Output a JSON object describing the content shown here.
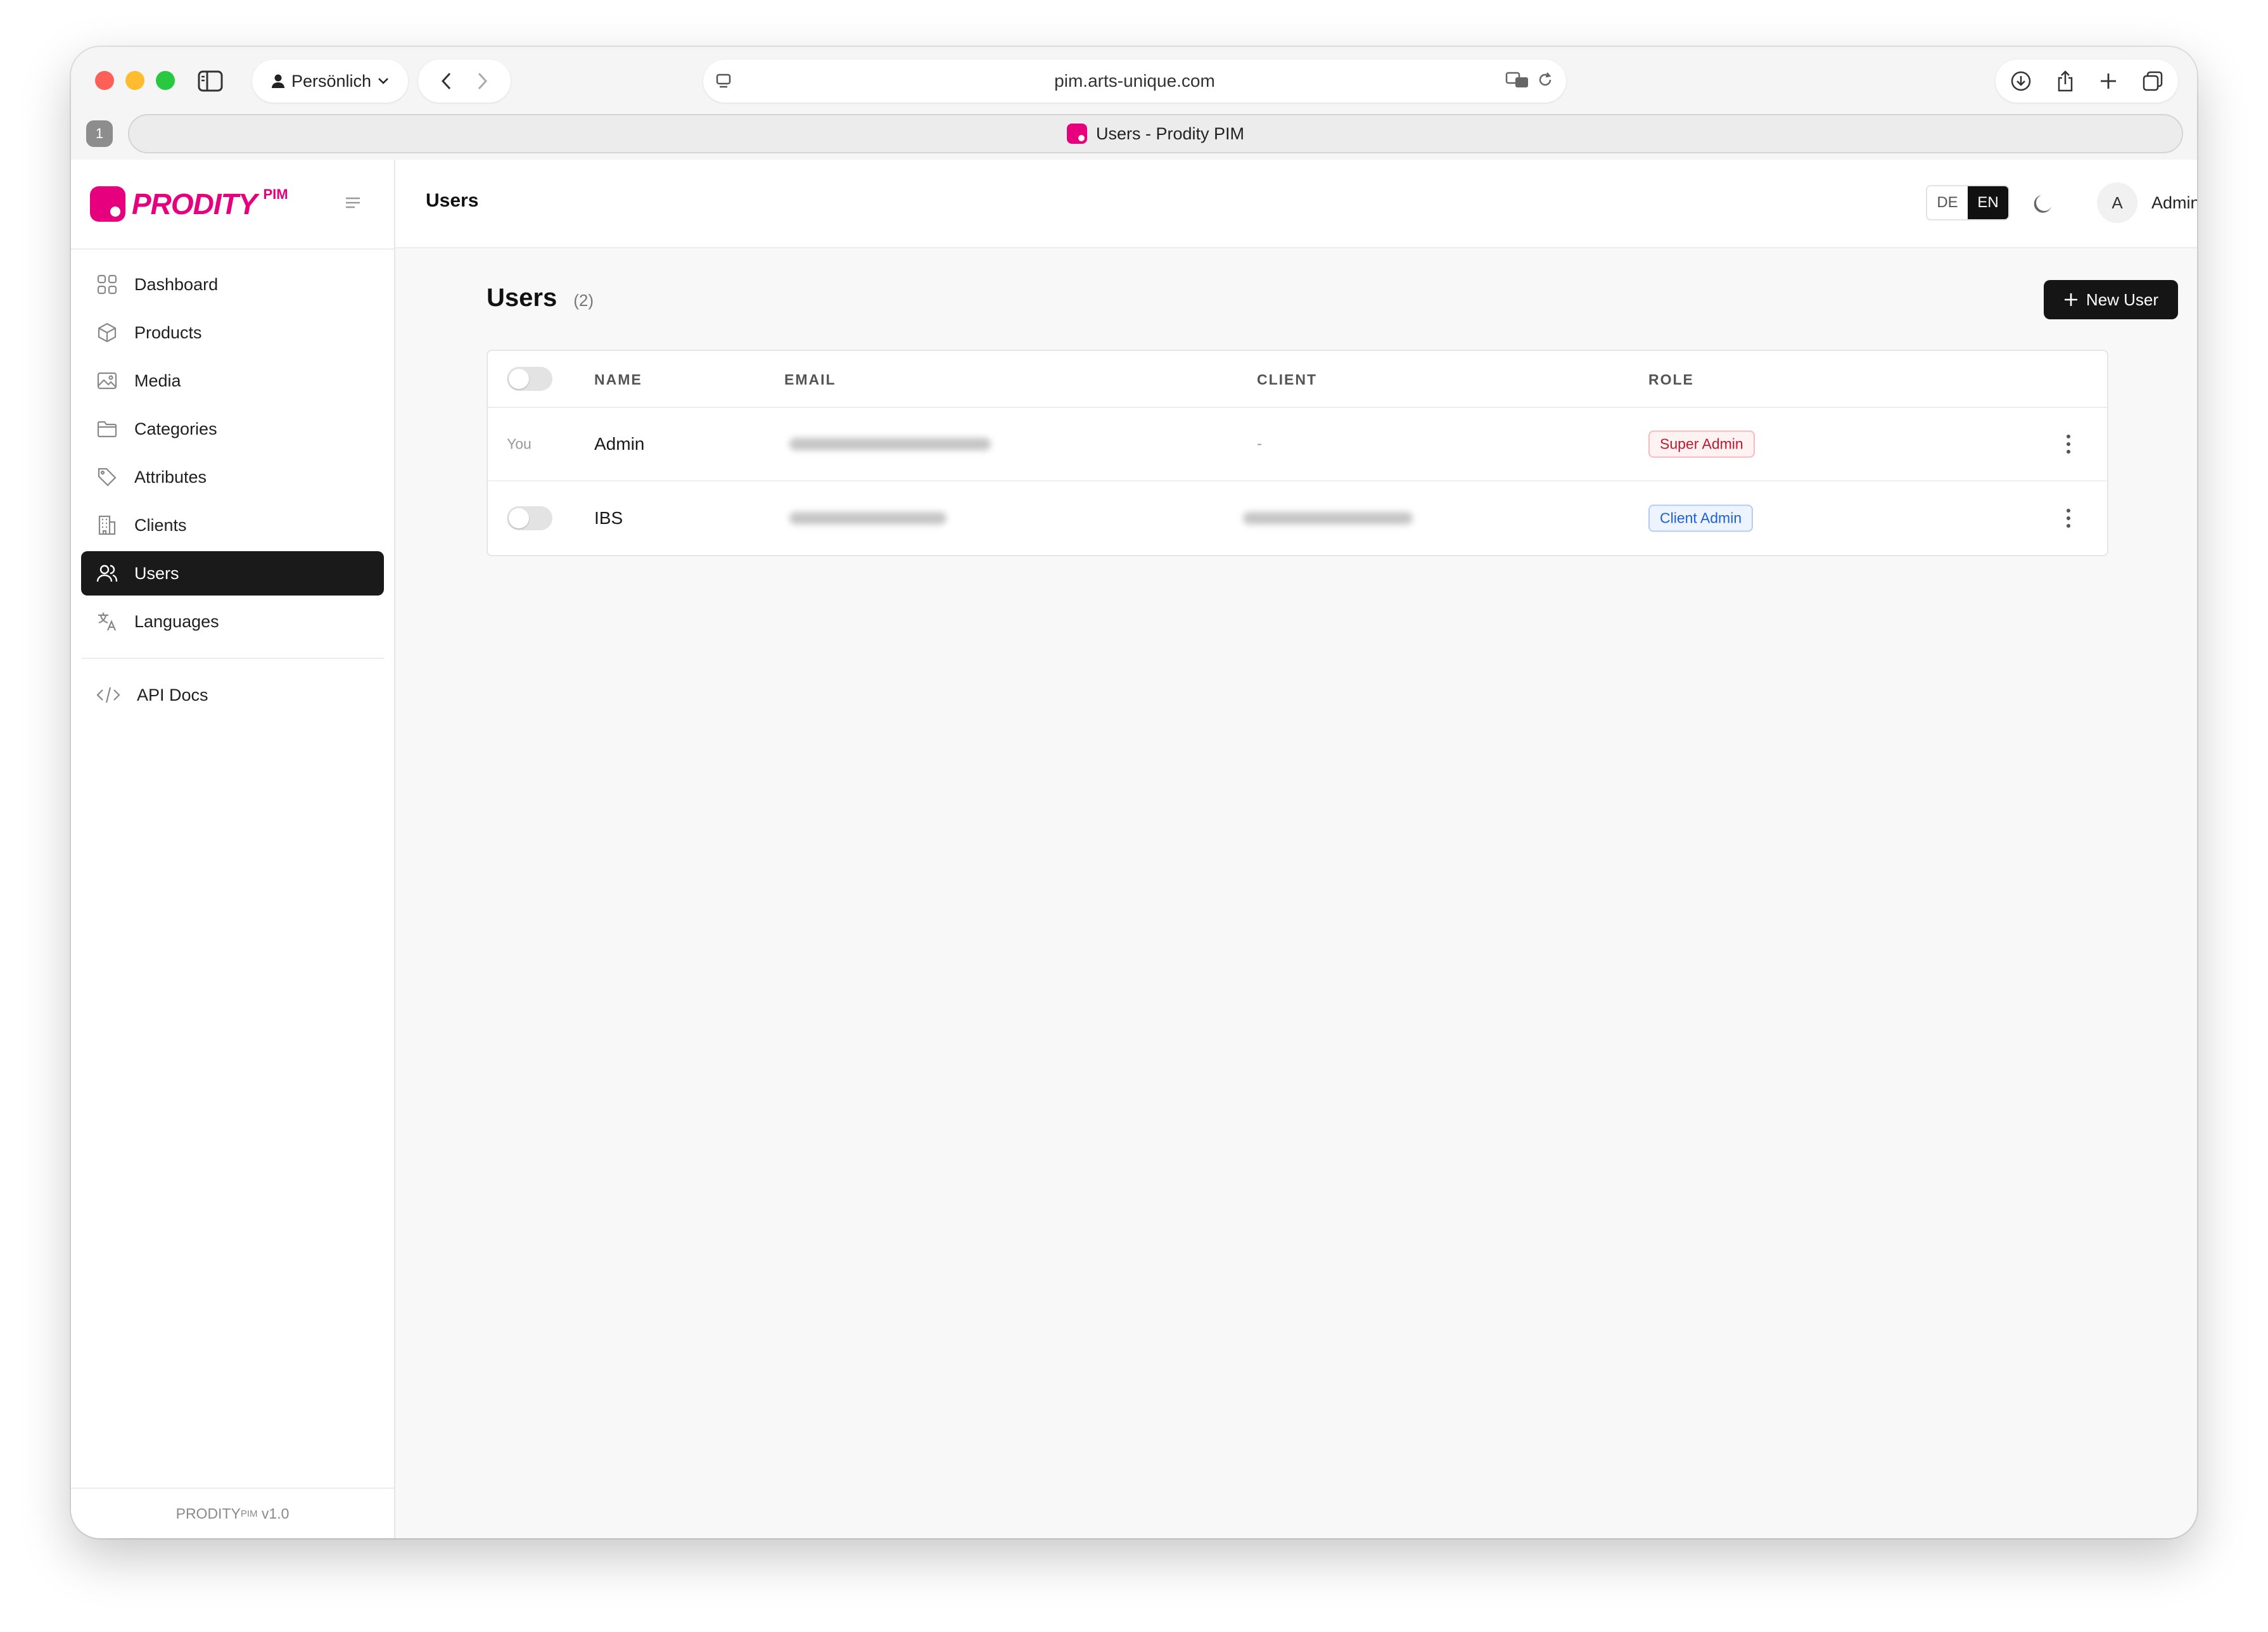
{
  "browser": {
    "profile_label": "Persönlich",
    "url": "pim.arts-unique.com",
    "tab_count": "1",
    "tab_title": "Users - Prodity PIM"
  },
  "brand": {
    "logo_text": "PRODITY",
    "logo_sup": "PIM",
    "accent_color": "#e6007e"
  },
  "sidebar": {
    "items": [
      {
        "label": "Dashboard",
        "icon": "dashboard-grid-icon"
      },
      {
        "label": "Products",
        "icon": "box-icon"
      },
      {
        "label": "Media",
        "icon": "image-icon"
      },
      {
        "label": "Categories",
        "icon": "folder-icon"
      },
      {
        "label": "Attributes",
        "icon": "tag-icon"
      },
      {
        "label": "Clients",
        "icon": "building-icon"
      },
      {
        "label": "Users",
        "icon": "users-icon",
        "active": true
      },
      {
        "label": "Languages",
        "icon": "translate-icon"
      }
    ],
    "extra": {
      "label": "API Docs",
      "icon": "code-icon"
    },
    "footer": {
      "brand": "PRODITY",
      "sup": "PIM",
      "version": "v1.0"
    }
  },
  "header": {
    "title": "Users",
    "lang_de": "DE",
    "lang_en": "EN",
    "user_initial": "A",
    "user_name": "Admin"
  },
  "page": {
    "title": "Users",
    "count": "(2)",
    "new_button": "New User"
  },
  "table": {
    "columns": [
      "NAME",
      "EMAIL",
      "CLIENT",
      "ROLE"
    ],
    "rows": [
      {
        "marker": "You",
        "name": "Admin",
        "email": "",
        "client": "-",
        "role": "Super Admin"
      },
      {
        "marker": "",
        "name": "IBS",
        "email": "",
        "client": "",
        "role": "Client Admin"
      }
    ]
  }
}
